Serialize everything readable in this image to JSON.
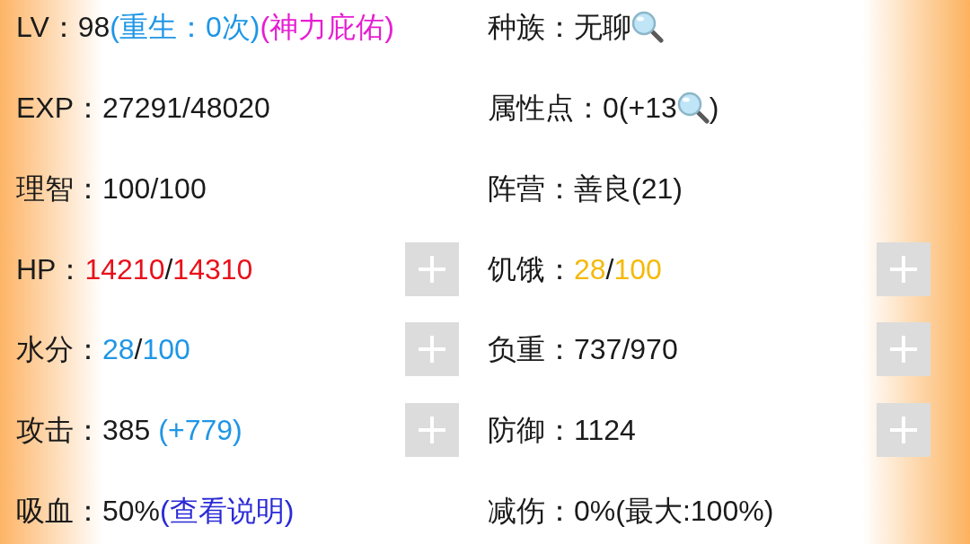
{
  "rows": [
    {
      "cells": [
        {
          "label": "LV：",
          "parts": [
            {
              "kind": "text",
              "text": "98",
              "color": "#1a1a1a"
            },
            {
              "kind": "text",
              "text": "(重生：0次)",
              "color": "#1e96e6"
            },
            {
              "kind": "text",
              "text": "(神力庇佑)",
              "color": "#e61ed2"
            }
          ],
          "add_button": false
        },
        {
          "label": "种族：",
          "parts": [
            {
              "kind": "text",
              "text": "无聊",
              "color": "#1a1a1a"
            },
            {
              "kind": "icon"
            }
          ],
          "add_button": false
        }
      ]
    },
    {
      "cells": [
        {
          "label": "EXP：",
          "parts": [
            {
              "kind": "text",
              "text": "27291/48020",
              "color": "#1a1a1a"
            }
          ],
          "add_button": false
        },
        {
          "label": "属性点：",
          "parts": [
            {
              "kind": "text",
              "text": "0(+13",
              "color": "#1a1a1a"
            },
            {
              "kind": "icon"
            },
            {
              "kind": "text",
              "text": ")",
              "color": "#1a1a1a"
            }
          ],
          "add_button": false
        }
      ]
    },
    {
      "cells": [
        {
          "label": "理智：",
          "parts": [
            {
              "kind": "text",
              "text": "100/100",
              "color": "#1a1a1a"
            }
          ],
          "add_button": false
        },
        {
          "label": "阵营：",
          "parts": [
            {
              "kind": "text",
              "text": "善良(21)",
              "color": "#1a1a1a"
            }
          ],
          "add_button": false
        }
      ]
    },
    {
      "cells": [
        {
          "label": "HP：",
          "parts": [
            {
              "kind": "text",
              "text": "14210",
              "color": "#e8101a"
            },
            {
              "kind": "text",
              "text": "/",
              "color": "#1a1a1a"
            },
            {
              "kind": "text",
              "text": "14310",
              "color": "#e8101a"
            }
          ],
          "add_button": true
        },
        {
          "label": "饥饿：",
          "parts": [
            {
              "kind": "text",
              "text": "28",
              "color": "#f5b90a"
            },
            {
              "kind": "text",
              "text": "/",
              "color": "#1a1a1a"
            },
            {
              "kind": "text",
              "text": "100",
              "color": "#f5b90a"
            }
          ],
          "add_button": true
        }
      ]
    },
    {
      "cells": [
        {
          "label": "水分：",
          "parts": [
            {
              "kind": "text",
              "text": "28",
              "color": "#1e96e6"
            },
            {
              "kind": "text",
              "text": "/",
              "color": "#1a1a1a"
            },
            {
              "kind": "text",
              "text": "100",
              "color": "#1e96e6"
            }
          ],
          "add_button": true
        },
        {
          "label": "负重：",
          "parts": [
            {
              "kind": "text",
              "text": "737/970",
              "color": "#1a1a1a"
            }
          ],
          "add_button": true
        }
      ]
    },
    {
      "cells": [
        {
          "label": "攻击：",
          "parts": [
            {
              "kind": "text",
              "text": "385",
              "color": "#1a1a1a"
            },
            {
              "kind": "text",
              "text": " (+779)",
              "color": "#1e96e6"
            }
          ],
          "add_button": true
        },
        {
          "label": "防御：",
          "parts": [
            {
              "kind": "text",
              "text": "1124",
              "color": "#1a1a1a"
            }
          ],
          "add_button": true
        }
      ]
    },
    {
      "cells": [
        {
          "label": "吸血：",
          "parts": [
            {
              "kind": "text",
              "text": "50%",
              "color": "#1a1a1a"
            },
            {
              "kind": "link",
              "text": "(查看说明)",
              "color": "#2a2ad6"
            }
          ],
          "add_button": false
        },
        {
          "label": "减伤：",
          "parts": [
            {
              "kind": "text",
              "text": "0%(最大:100%)",
              "color": "#1a1a1a"
            }
          ],
          "add_button": false
        }
      ]
    }
  ]
}
